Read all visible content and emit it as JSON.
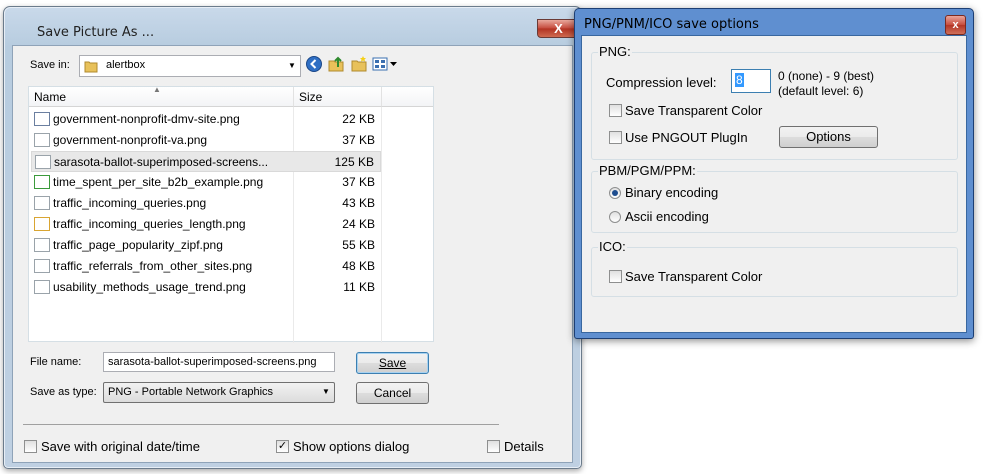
{
  "save_dialog": {
    "title": "Save Picture As ...",
    "close_glyph": "X",
    "save_in_label": "Save in:",
    "save_in_mnemonic": "I",
    "save_in_value": "alertbox",
    "columns": {
      "name": "Name",
      "size": "Size"
    },
    "files": [
      {
        "name": "government-nonprofit-dmv-site.png",
        "size": "22 KB"
      },
      {
        "name": "government-nonprofit-va.png",
        "size": "37 KB"
      },
      {
        "name": "sarasota-ballot-superimposed-screens...",
        "size": "125 KB"
      },
      {
        "name": "time_spent_per_site_b2b_example.png",
        "size": "37 KB"
      },
      {
        "name": "traffic_incoming_queries.png",
        "size": "43 KB"
      },
      {
        "name": "traffic_incoming_queries_length.png",
        "size": "24 KB"
      },
      {
        "name": "traffic_page_popularity_zipf.png",
        "size": "55 KB"
      },
      {
        "name": "traffic_referrals_from_other_sites.png",
        "size": "48 KB"
      },
      {
        "name": "usability_methods_usage_trend.png",
        "size": "11 KB"
      }
    ],
    "selected_index": 2,
    "file_name_label": "File name:",
    "file_name_value": "sarasota-ballot-superimposed-screens.png",
    "save_type_label": "Save as type:",
    "save_type_value": "PNG - Portable Network Graphics",
    "save_button": "Save",
    "cancel_button": "Cancel",
    "original_date_label": "Save with original date/time",
    "original_date_checked": false,
    "show_options_label": "Show options dialog",
    "show_options_checked": true,
    "details_label": "Details",
    "details_checked": false,
    "check_glyph": "✓"
  },
  "options_dialog": {
    "title": "PNG/PNM/ICO save options",
    "close_glyph": "x",
    "png_group": "PNG:",
    "compression_label": "Compression level:",
    "compression_value": "8",
    "compression_hint_1": "0 (none) - 9 (best)",
    "compression_hint_2": "(default level: 6)",
    "png_transparent_label": "Save Transparent Color",
    "png_transparent_checked": false,
    "pngout_label": "Use PNGOUT PlugIn",
    "pngout_checked": false,
    "options_button": "Options",
    "pnm_group": "PBM/PGM/PPM:",
    "binary_label": "Binary encoding",
    "binary_selected": true,
    "ascii_label": "Ascii encoding",
    "ascii_selected": false,
    "ico_group": "ICO:",
    "ico_transparent_label": "Save Transparent Color",
    "ico_transparent_checked": false
  }
}
